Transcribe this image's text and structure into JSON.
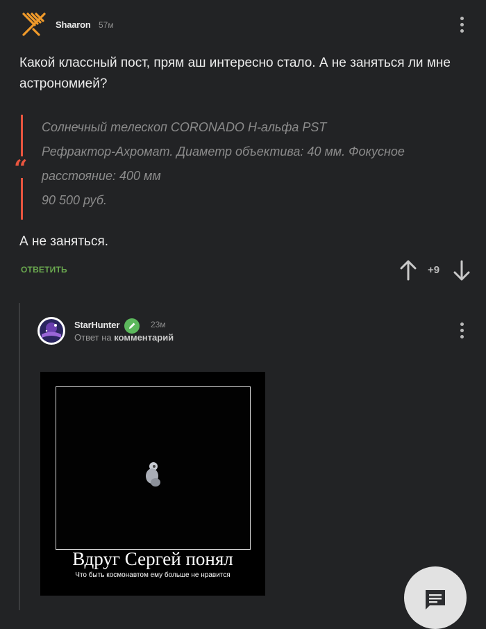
{
  "comment1": {
    "username": "Shaaron",
    "time": "57м",
    "paragraph1": "Какой классный пост, прям аш интересно стало. А не заняться ли мне астрономией?",
    "quote_lines": [
      "Солнечный телескоп CORONADO H-альфа PST",
      "Рефрактор-Ахромат. Диаметр объектива: 40 мм. Фокусное",
      "расстояние: 400 мм",
      "90 500 руб."
    ],
    "paragraph2": "А не заняться.",
    "reply_label": "ОТВЕТИТЬ",
    "rating": "+9"
  },
  "comment2": {
    "username": "StarHunter",
    "time": "23м",
    "reply_to_prefix": "Ответ на",
    "reply_to_link": "комментарий",
    "image": {
      "caption_title": "Вдруг Сергей понял",
      "caption_subtitle": "Что быть космонавтом ему больше не нравится"
    }
  },
  "colors": {
    "background": "#222325",
    "accent_orange": "#f09a2a",
    "quote_bar": "#e8553f",
    "reply_green": "#6aa84f",
    "edit_badge": "#5cb85c"
  },
  "icons": {
    "comment1_avatar": "orange-hatched-logo",
    "fab": "comment-icon"
  }
}
